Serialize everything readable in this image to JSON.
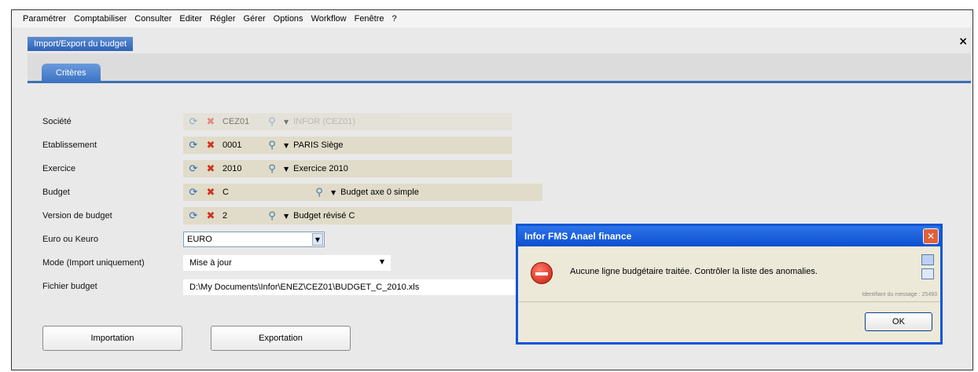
{
  "menu": [
    "Paramétrer",
    "Comptabiliser",
    "Consulter",
    "Editer",
    "Régler",
    "Gérer",
    "Options",
    "Workflow",
    "Fenêtre",
    "?"
  ],
  "window": {
    "tab_title": "Import/Export du budget",
    "close_glyph": "×"
  },
  "tabs": {
    "active": "Critères"
  },
  "form": {
    "societe": {
      "label": "Société",
      "code": "CEZ01",
      "desc": "INFOR (CEZ01)"
    },
    "etablissement": {
      "label": "Etablissement",
      "code": "0001",
      "desc": "PARIS Siège"
    },
    "exercice": {
      "label": "Exercice",
      "code": "2010",
      "desc": "Exercice 2010"
    },
    "budget": {
      "label": "Budget",
      "code": "C",
      "desc": "Budget axe 0 simple"
    },
    "version": {
      "label": "Version de budget",
      "code": "2",
      "desc": "Budget révisé C"
    },
    "euro": {
      "label": "Euro ou Keuro",
      "value": "EURO"
    },
    "mode": {
      "label": "Mode (Import uniquement)",
      "value": "Mise à jour"
    },
    "fichier": {
      "label": "Fichier budget",
      "value": "D:\\My Documents\\Infor\\ENEZ\\CEZ01\\BUDGET_C_2010.xls"
    }
  },
  "buttons": {
    "import": "Importation",
    "export": "Exportation"
  },
  "dialog": {
    "title": "Infor FMS Anael finance",
    "message": "Aucune ligne budgétaire traitée. Contrôler la liste des anomalies.",
    "msg_id": "Identifiant du message : 25493",
    "ok": "OK"
  },
  "icons": {
    "refresh": "refresh-icon",
    "delete": "delete-icon",
    "search": "magnifier-icon",
    "dropdown": "chevron-down-icon",
    "error": "error-icon"
  },
  "colors": {
    "accent": "#2e63b8",
    "dialog_title": "#0a4fd0",
    "field_strip": "#e0dcc9",
    "error": "#c8180b"
  }
}
